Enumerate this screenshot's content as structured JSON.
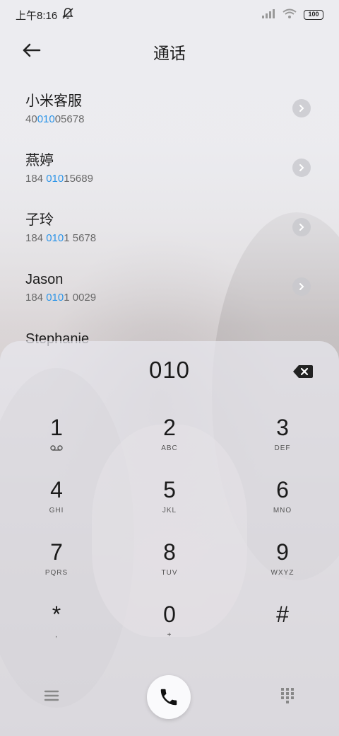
{
  "status_bar": {
    "time": "上午8:16",
    "battery": "100"
  },
  "header": {
    "title": "通话"
  },
  "contacts": [
    {
      "name": "小米客服",
      "number_parts": [
        "40",
        "010",
        "05678"
      ]
    },
    {
      "name": "燕婷",
      "number_parts": [
        "184 ",
        "010",
        "15689"
      ]
    },
    {
      "name": "子玲",
      "number_parts": [
        "184 ",
        "010",
        "1 5678"
      ]
    },
    {
      "name": "Jason",
      "number_parts": [
        "184 ",
        "010",
        "1 0029"
      ]
    },
    {
      "name": "Stephanie",
      "number_parts": [
        "",
        "",
        ""
      ]
    }
  ],
  "dialer": {
    "input": "010",
    "keys": [
      {
        "digit": "1",
        "sub": ""
      },
      {
        "digit": "2",
        "sub": "ABC"
      },
      {
        "digit": "3",
        "sub": "DEF"
      },
      {
        "digit": "4",
        "sub": "GHI"
      },
      {
        "digit": "5",
        "sub": "JKL"
      },
      {
        "digit": "6",
        "sub": "MNO"
      },
      {
        "digit": "7",
        "sub": "PQRS"
      },
      {
        "digit": "8",
        "sub": "TUV"
      },
      {
        "digit": "9",
        "sub": "WXYZ"
      },
      {
        "digit": "*",
        "sub": ","
      },
      {
        "digit": "0",
        "sub": "+"
      },
      {
        "digit": "#",
        "sub": ""
      }
    ]
  },
  "icons": {
    "mute": "bell-off-icon",
    "signal": "signal-icon",
    "wifi": "wifi-icon",
    "back": "arrow-left-icon",
    "chevron": "chevron-right-icon",
    "backspace": "backspace-icon",
    "voicemail": "voicemail-icon",
    "menu": "menu-icon",
    "call": "phone-icon",
    "keypad": "keypad-icon"
  },
  "colors": {
    "highlight": "#2d95e8"
  }
}
